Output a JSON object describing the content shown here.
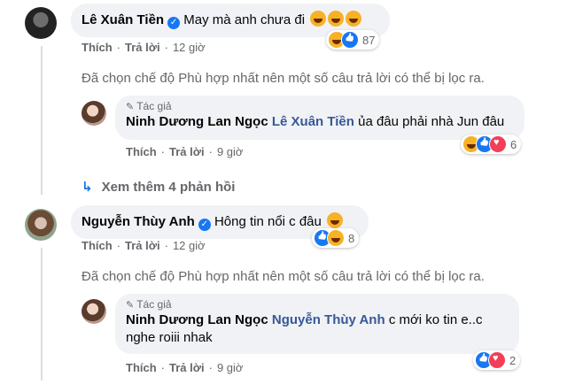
{
  "comment1": {
    "author": "Lê Xuân Tiền",
    "text": "May mà anh chưa đi",
    "like_label": "Thích",
    "reply_label": "Trả lời",
    "time": "12 giờ",
    "reaction_count": "87"
  },
  "filter_note": "Đã chọn chế độ Phù hợp nhất nên một số câu trả lời có thể bị lọc ra.",
  "reply1": {
    "badge": "Tác giả",
    "author": "Ninh Dương Lan Ngọc",
    "mention": "Lê Xuân Tiền",
    "text": "ủa đâu phải nhà Jun đâu",
    "like_label": "Thích",
    "reply_label": "Trả lời",
    "time": "9 giờ",
    "reaction_count": "6"
  },
  "more_replies": "Xem thêm 4 phản hồi",
  "comment2": {
    "author": "Nguyễn Thùy Anh",
    "text": "Hông tin nổi c đâu",
    "like_label": "Thích",
    "reply_label": "Trả lời",
    "time": "12 giờ",
    "reaction_count": "8"
  },
  "filter_note2": "Đã chọn chế độ Phù hợp nhất nên một số câu trả lời có thể bị lọc ra.",
  "reply2": {
    "badge": "Tác giả",
    "author": "Ninh Dương Lan Ngọc",
    "mention": "Nguyễn Thùy Anh",
    "text_line1": "c mới ko tin e..c",
    "text_line2": "nghe roiii nhak",
    "like_label": "Thích",
    "reply_label": "Trả lời",
    "time": "9 giờ",
    "reaction_count": "2"
  },
  "colors": {
    "link": "#385898",
    "muted": "#65676b",
    "bubble": "#f0f2f5",
    "accent": "#1877f2"
  },
  "icons": [
    "verified-badge-icon",
    "haha-reaction-icon",
    "like-reaction-icon",
    "love-reaction-icon",
    "reply-arrow-icon",
    "pen-icon"
  ]
}
